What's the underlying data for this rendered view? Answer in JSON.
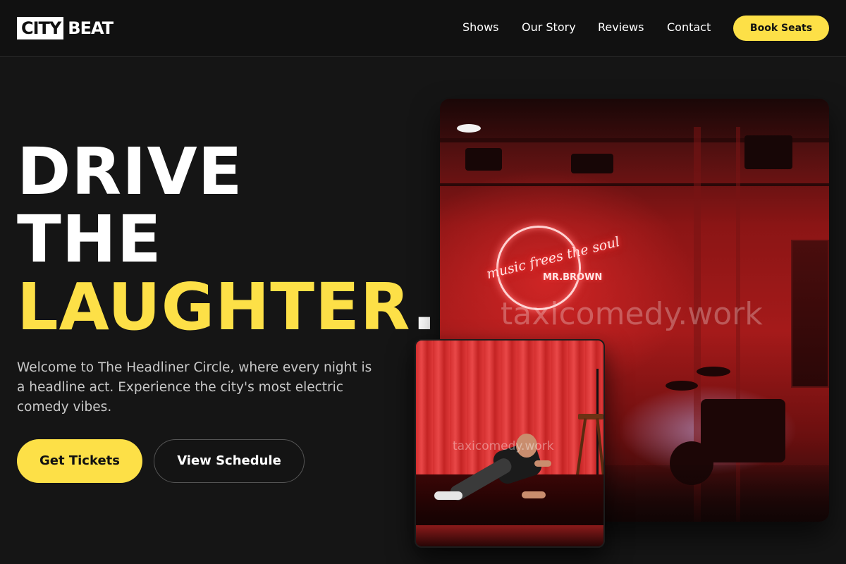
{
  "header": {
    "logo_box": "CITY",
    "logo_text": "BEAT",
    "nav": [
      {
        "label": "Shows"
      },
      {
        "label": "Our Story"
      },
      {
        "label": "Reviews"
      },
      {
        "label": "Contact"
      }
    ],
    "cta_label": "Book Seats"
  },
  "hero": {
    "headline_line1": "DRIVE",
    "headline_line2": "THE",
    "headline_accent": "LAUGHTER",
    "headline_dot": ".",
    "subtext": "Welcome to The Headliner Circle, where every night is a headline act. Experience the city's most electric comedy vibes.",
    "primary_button": "Get Tickets",
    "secondary_button": "View Schedule"
  },
  "images": {
    "venue": {
      "neon_text": "music frees the soul",
      "neon_sub": "MR.BROWN",
      "watermark": "taxicomedy.work"
    },
    "performer": {
      "watermark": "taxicomedy.work"
    }
  },
  "colors": {
    "background": "#151515",
    "header_background": "#111111",
    "accent": "#fde047",
    "text": "#ffffff",
    "muted_text": "#c9c9c9"
  },
  "icons": []
}
